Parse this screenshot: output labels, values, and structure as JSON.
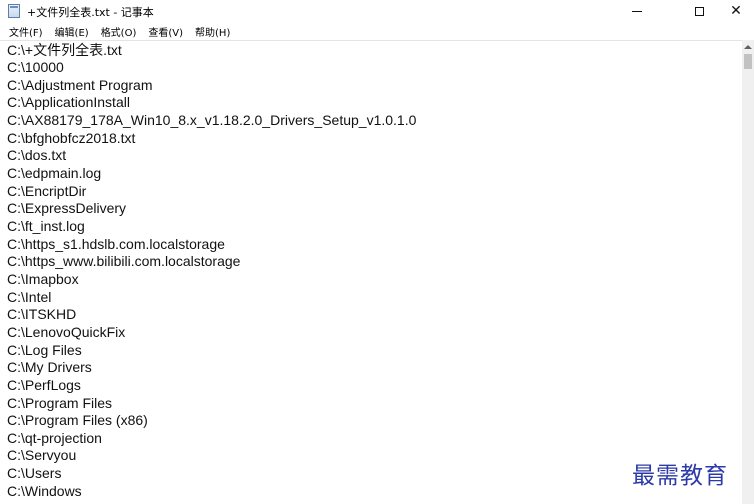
{
  "window": {
    "title": "+文件列全表.txt - 记事本",
    "controls": {
      "minimize": "—",
      "maximize": "☐",
      "close": "✕"
    }
  },
  "menu": {
    "items": [
      "文件(F)",
      "编辑(E)",
      "格式(O)",
      "查看(V)",
      "帮助(H)"
    ]
  },
  "editor": {
    "lines": [
      "C:\\+文件列全表.txt",
      "C:\\10000",
      "C:\\Adjustment Program",
      "C:\\ApplicationInstall",
      "C:\\AX88179_178A_Win10_8.x_v1.18.2.0_Drivers_Setup_v1.0.1.0",
      "C:\\bfghobfcz2018.txt",
      "C:\\dos.txt",
      "C:\\edpmain.log",
      "C:\\EncriptDir",
      "C:\\ExpressDelivery",
      "C:\\ft_inst.log",
      "C:\\https_s1.hdslb.com.localstorage",
      "C:\\https_www.bilibili.com.localstorage",
      "C:\\Imapbox",
      "C:\\Intel",
      "C:\\ITSKHD",
      "C:\\LenovoQuickFix",
      "C:\\Log Files",
      "C:\\My Drivers",
      "C:\\PerfLogs",
      "C:\\Program Files",
      "C:\\Program Files (x86)",
      "C:\\qt-projection",
      "C:\\Servyou",
      "C:\\Users",
      "C:\\Windows"
    ]
  },
  "watermark": {
    "text": "最需教育",
    "color": "#2c3aa8"
  },
  "icons": {
    "app": "notepad-icon",
    "scroll_up": "scroll-up-arrow-icon"
  }
}
